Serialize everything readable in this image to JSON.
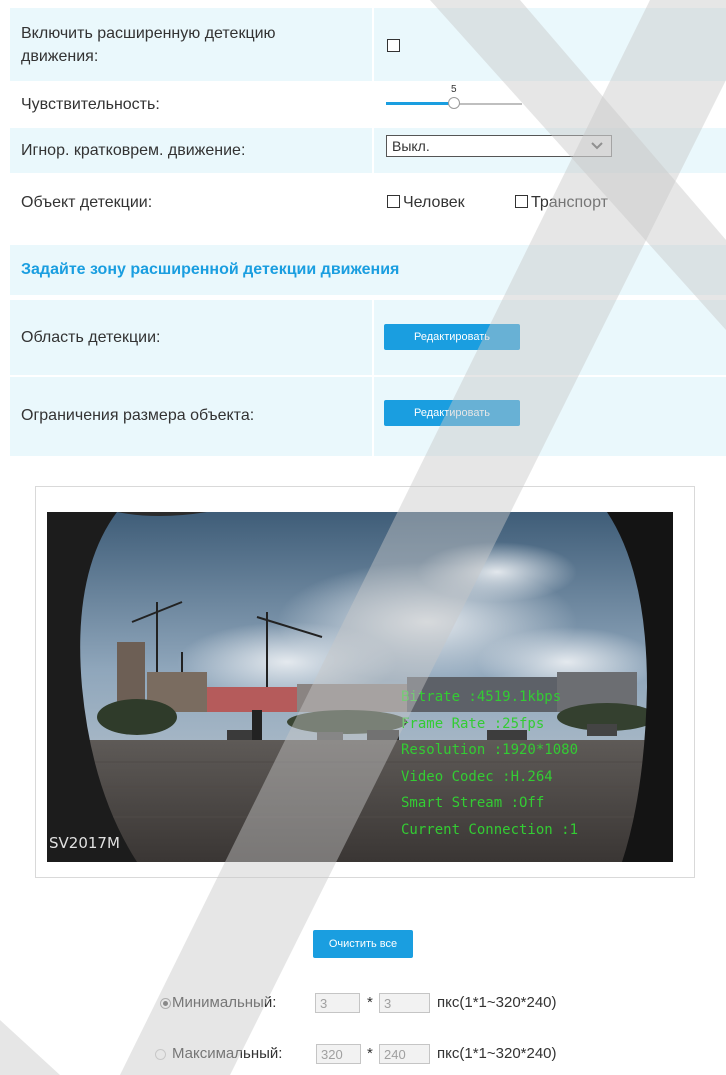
{
  "settings": {
    "advanced_motion": {
      "label": "Включить расширенную детекцию движения:",
      "checked": false
    },
    "sensitivity": {
      "label": "Чувствительность:",
      "value": 5,
      "min": 0,
      "max": 10
    },
    "ignore_short": {
      "label": "Игнор. кратковрем. движение:",
      "selected": "Выкл."
    },
    "detection_object": {
      "label": "Объект детекции:",
      "person": "Человек",
      "vehicle": "Транспорт",
      "person_checked": false,
      "vehicle_checked": false
    }
  },
  "zone": {
    "title": "Задайте зону расширенной детекции движения",
    "area_label": "Область детекции:",
    "size_label": "Ограничения размера объекта:",
    "edit_button": "Редактировать"
  },
  "video": {
    "camera_name": "SV2017M",
    "overlay": [
      "Bitrate :4519.1kbps",
      "Frame Rate :25fps",
      "Resolution :1920*1080",
      "Video Codec :H.264",
      "Smart Stream :Off",
      "Current Connection :1"
    ]
  },
  "clear_button": "Очистить все",
  "size": {
    "min": {
      "label": "Минимальный:",
      "w": "3",
      "h": "3",
      "range": "пкс(1*1~320*240)",
      "selected": true
    },
    "max": {
      "label": "Максимальный:",
      "w": "320",
      "h": "240",
      "range": "пкс(1*1~320*240)",
      "selected": false
    },
    "times": "*"
  },
  "colors": {
    "accent": "#1a9ee0",
    "row_bg": "#eaf8fc",
    "title": "#1a9ee0",
    "overlay": "#33cc33"
  }
}
